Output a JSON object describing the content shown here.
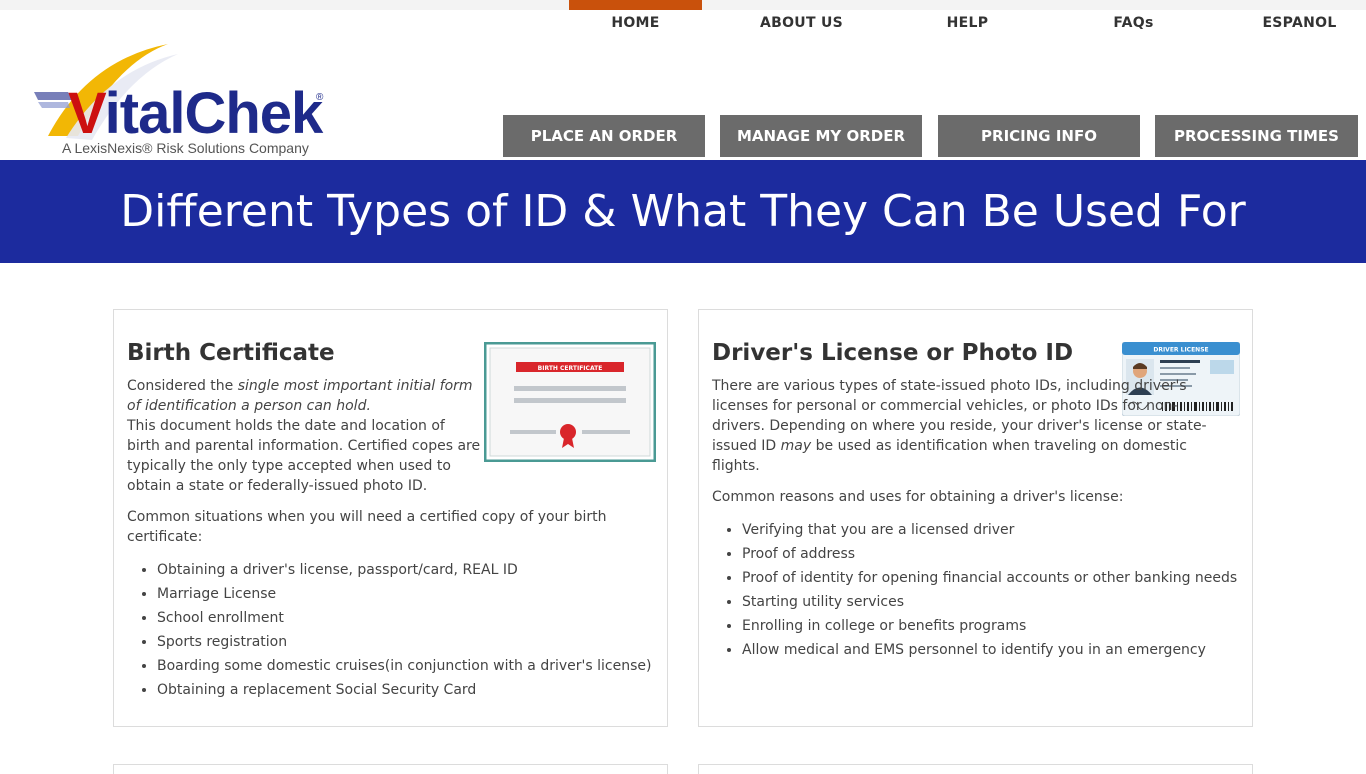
{
  "topnav": {
    "items": [
      {
        "label": "HOME",
        "active": true
      },
      {
        "label": "ABOUT US"
      },
      {
        "label": "HELP"
      },
      {
        "label": "FAQs"
      },
      {
        "label": "ESPANOL"
      }
    ],
    "active_color": "#c9510c"
  },
  "logo": {
    "brand_v": "V",
    "brand_rest": "italChek",
    "reg": "®",
    "subtitle": "A LexisNexis® Risk Solutions Company"
  },
  "actions": [
    {
      "label": "PLACE AN ORDER"
    },
    {
      "label": "MANAGE MY ORDER"
    },
    {
      "label": "PRICING INFO"
    },
    {
      "label": "PROCESSING TIMES"
    }
  ],
  "banner": {
    "title": "Different Types of ID & What They Can Be Used For",
    "color": "#1c2b9e"
  },
  "cards": {
    "birth": {
      "title": "Birth Certificate",
      "intro_prefix": "Considered the ",
      "intro_em": "single most important initial form of identification a person can hold.",
      "body": "This document holds the date and location of birth and parental information. Certified copes are typically the only type accepted when used to obtain a state or federally-issued photo ID.",
      "lead": "Common situations when you will need a certified copy of your birth certificate:",
      "items": [
        "Obtaining a driver's license, passport/card, REAL ID",
        "Marriage License",
        "School enrollment",
        "Sports registration",
        "Boarding some domestic cruises(in conjunction with a driver's license)",
        "Obtaining a replacement Social Security Card"
      ],
      "image_label": "BIRTH CERTIFICATE"
    },
    "license": {
      "title": "Driver's License or Photo ID",
      "body_a": "There are various types of state-issued photo IDs, including driver's licenses for personal or commercial vehicles, or photo IDs for non-drivers. Depending on where you reside, your driver's license or state-issued ID ",
      "body_em": "may",
      "body_b": " be used as identification when traveling on domestic flights.",
      "lead": "Common reasons and uses for obtaining a driver's license:",
      "items": [
        "Verifying that you are a licensed driver",
        "Proof of address",
        "Proof of identity for opening financial accounts or other banking needs",
        "Starting utility services",
        "Enrolling in college or benefits programs",
        "Allow medical and EMS personnel to identify you in an emergency"
      ],
      "image_label": "DRIVER LICENSE"
    }
  }
}
